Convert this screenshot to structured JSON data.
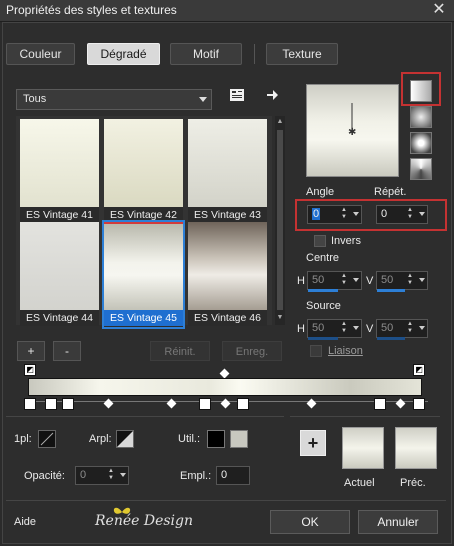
{
  "window": {
    "title": "Propriétés des styles et textures",
    "close_glyph": "✕"
  },
  "tabs": [
    {
      "label": "Couleur",
      "active": false
    },
    {
      "label": "Dégradé",
      "active": true
    },
    {
      "label": "Motif",
      "active": false
    },
    {
      "label": "Texture",
      "active": false
    }
  ],
  "category": {
    "selected": "Tous"
  },
  "gradients": [
    {
      "label": "ES Vintage 41",
      "colors": [
        "#f7f7ea",
        "#e2e2cf"
      ]
    },
    {
      "label": "ES Vintage 42",
      "colors": [
        "#efeedc",
        "#d9d8c0"
      ]
    },
    {
      "label": "ES Vintage 43",
      "colors": [
        "#eeeee6",
        "#d3d3c9"
      ]
    },
    {
      "label": "ES Vintage 44",
      "colors": [
        "#e2e2de",
        "#d2d2cd"
      ]
    },
    {
      "label": "ES Vintage 45",
      "colors": [
        "#b9b9ad",
        "#f5f5ef"
      ],
      "selected": true
    },
    {
      "label": "ES Vintage 46",
      "colors": [
        "#6f645a",
        "#e5e1da"
      ]
    }
  ],
  "buttons": {
    "add": "+",
    "remove": "-",
    "reset": "Réinit.",
    "save": "Enreg.",
    "ok": "OK",
    "cancel": "Annuler",
    "plus_big": "+"
  },
  "angle": {
    "label": "Angle",
    "value": "0"
  },
  "repeat": {
    "label": "Répét.",
    "value": "0"
  },
  "invert": {
    "label": "Invers"
  },
  "center": {
    "label": "Centre",
    "h": "50",
    "v": "50",
    "h_label": "H",
    "v_label": "V"
  },
  "source": {
    "label": "Source",
    "h": "50",
    "v": "50",
    "h_label": "H",
    "v_label": "V"
  },
  "link": {
    "label": "Liaison"
  },
  "editor": {
    "one_pl_label": "1pl:",
    "arpl_label": "Arpl:",
    "util_label": "Util.:",
    "opacity_label": "Opacité:",
    "opacity_value": "0",
    "empl_label": "Empl.:",
    "empl_value": "0"
  },
  "preview_labels": {
    "current": "Actuel",
    "previous": "Préc."
  },
  "footer": {
    "help": "Aide",
    "brand": "Renée Design"
  },
  "colors": {
    "accent": "#2d7fd6",
    "highlight_red": "#c43232"
  }
}
